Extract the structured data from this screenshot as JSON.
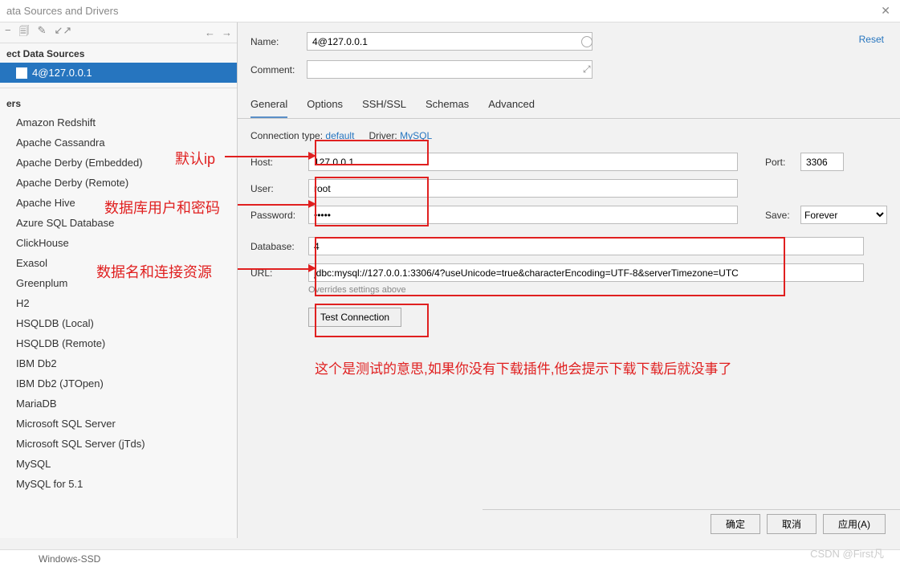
{
  "title": "ata Sources and Drivers",
  "toolbar_icons": {
    "minus": "−",
    "copy": "🗐",
    "wrench": "✎",
    "arrows": "↙↗",
    "left": "←",
    "right": "→"
  },
  "left": {
    "section_ds": "ect Data Sources",
    "ds_selected": "4@127.0.0.1",
    "section_drivers": "ers",
    "drivers": [
      "Amazon Redshift",
      "Apache Cassandra",
      "Apache Derby (Embedded)",
      "Apache Derby (Remote)",
      "Apache Hive",
      "Azure SQL Database",
      "ClickHouse",
      "Exasol",
      "Greenplum",
      "H2",
      "HSQLDB (Local)",
      "HSQLDB (Remote)",
      "IBM Db2",
      "IBM Db2 (JTOpen)",
      "MariaDB",
      "Microsoft SQL Server",
      "Microsoft SQL Server (jTds)",
      "MySQL",
      "MySQL for 5.1"
    ]
  },
  "reset": "Reset",
  "form": {
    "name_label": "Name:",
    "name_value": "4@127.0.0.1",
    "comment_label": "Comment:",
    "comment_value": ""
  },
  "tabs": [
    "General",
    "Options",
    "SSH/SSL",
    "Schemas",
    "Advanced"
  ],
  "general": {
    "conn_type_label": "Connection type:",
    "conn_type_value": "default",
    "driver_label": "Driver:",
    "driver_value": "MySQL",
    "host_label": "Host:",
    "host_value": "127.0.0.1",
    "port_label": "Port:",
    "port_value": "3306",
    "user_label": "User:",
    "user_value": "root",
    "password_label": "Password:",
    "password_value": "•••••",
    "save_label": "Save:",
    "save_value": "Forever",
    "database_label": "Database:",
    "database_value": "4",
    "url_label": "URL:",
    "url_value": "jdbc:mysql://127.0.0.1:3306/4?useUnicode=true&characterEncoding=UTF-8&serverTimezone=UTC",
    "override_text": "Overrides settings above",
    "test_btn": "Test Connection"
  },
  "footer": {
    "ok": "确定",
    "cancel": "取消",
    "apply": "应用(A)"
  },
  "annotations": {
    "ip": "默认ip",
    "userpwd": "数据库用户和密码",
    "dburl": "数据名和连接资源",
    "test": "这个是测试的意思,如果你没有下载插件,他会提示下载下载后就没事了"
  },
  "watermark": "CSDN @First凡",
  "bottom": {
    "left": "Windows-SSD"
  }
}
